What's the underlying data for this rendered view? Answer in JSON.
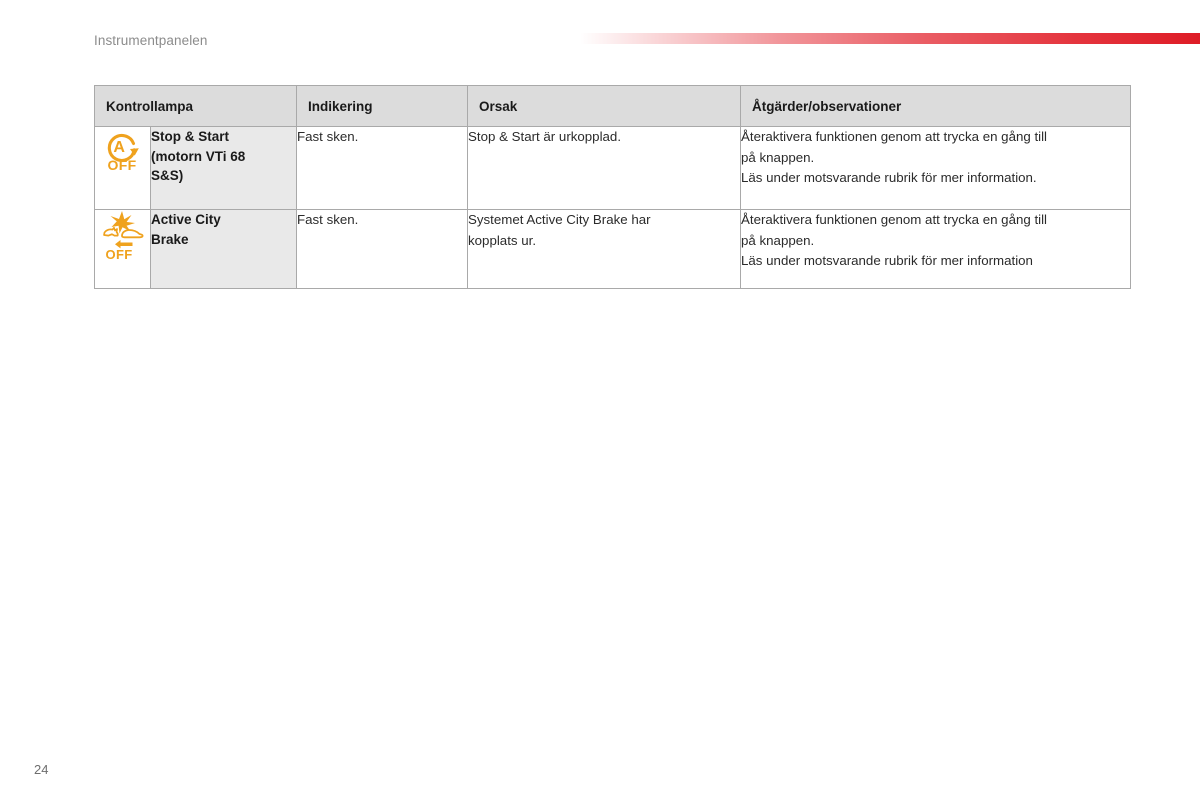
{
  "document": {
    "section_title": "Instrumentpanelen",
    "page_number": "24",
    "accent_color": "#de1c26",
    "warning_icon_color": "#efa21e",
    "header_bg_color": "#dcdcdc",
    "name_cell_bg_color": "#e9e9e9"
  },
  "table": {
    "headers": {
      "lamp": "Kontrollampa",
      "indication": "Indikering",
      "cause": "Orsak",
      "action": "Åtgärder/observationer"
    },
    "rows": [
      {
        "icon_name": "stop-start-off-icon",
        "icon_letter": "A",
        "icon_label": "OFF",
        "name": "Stop & Start\n(motorn VTi 68\nS&S)",
        "name_lines": [
          "Stop & Start",
          "(motorn VTi 68",
          "S&S)"
        ],
        "indication": "Fast sken.",
        "cause": "Stop & Start är urkopplad.",
        "action_lines": [
          "Återaktivera funktionen genom att trycka en gång till",
          "på knappen.",
          "Läs under motsvarande rubrik för mer information."
        ]
      },
      {
        "icon_name": "active-city-brake-off-icon",
        "icon_label": "OFF",
        "name": "Active City\nBrake",
        "name_lines": [
          "Active City",
          "Brake"
        ],
        "indication": "Fast sken.",
        "cause": "Systemet Active City Brake har kopplats ur.",
        "cause_lines": [
          "Systemet Active City Brake har",
          "kopplats ur."
        ],
        "action_lines": [
          "Återaktivera funktionen genom att trycka en gång till",
          "på knappen.",
          "Läs under motsvarande rubrik för mer information"
        ]
      }
    ]
  }
}
